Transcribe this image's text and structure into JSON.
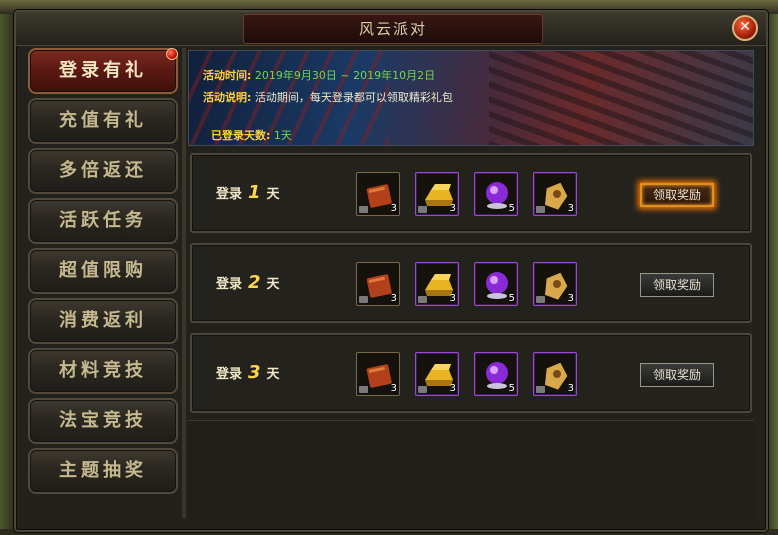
{
  "window": {
    "title": "风云派对"
  },
  "sidebar": {
    "items": [
      {
        "label": "登录有礼",
        "active": true
      },
      {
        "label": "充值有礼",
        "active": false
      },
      {
        "label": "多倍返还",
        "active": false
      },
      {
        "label": "活跃任务",
        "active": false
      },
      {
        "label": "超值限购",
        "active": false
      },
      {
        "label": "消费返利",
        "active": false
      },
      {
        "label": "材料竞技",
        "active": false
      },
      {
        "label": "法宝竞技",
        "active": false
      },
      {
        "label": "主题抽奖",
        "active": false
      }
    ]
  },
  "banner": {
    "time_label": "活动时间:",
    "time_value": "2019年9月30日 ~ 2019年10月2日",
    "desc_label": "活动说明:",
    "desc_value": "活动期间，每天登录都可以领取精彩礼包",
    "days_label": "已登录天数:",
    "days_value": "1天"
  },
  "rows": [
    {
      "prefix": "登录",
      "day": "1",
      "suffix": "天",
      "button": "领取奖励",
      "highlight": true,
      "items": [
        {
          "icon": "book-icon",
          "qty": "3"
        },
        {
          "icon": "gold-bar-icon",
          "qty": "3"
        },
        {
          "icon": "purple-orb-icon",
          "qty": "5"
        },
        {
          "icon": "token-icon",
          "qty": "3"
        }
      ]
    },
    {
      "prefix": "登录",
      "day": "2",
      "suffix": "天",
      "button": "领取奖励",
      "highlight": false,
      "items": [
        {
          "icon": "book-icon",
          "qty": "3"
        },
        {
          "icon": "gold-bar-icon",
          "qty": "3"
        },
        {
          "icon": "purple-orb-icon",
          "qty": "5"
        },
        {
          "icon": "token-icon",
          "qty": "3"
        }
      ]
    },
    {
      "prefix": "登录",
      "day": "3",
      "suffix": "天",
      "button": "领取奖励",
      "highlight": false,
      "items": [
        {
          "icon": "book-icon",
          "qty": "3"
        },
        {
          "icon": "gold-bar-icon",
          "qty": "3"
        },
        {
          "icon": "purple-orb-icon",
          "qty": "5"
        },
        {
          "icon": "token-icon",
          "qty": "3"
        }
      ]
    }
  ],
  "colors": {
    "accent_gold": "#ffd13a",
    "value_green": "#6fd74a",
    "active_red": "#5a1812",
    "button_glow": "#ff7a00"
  }
}
